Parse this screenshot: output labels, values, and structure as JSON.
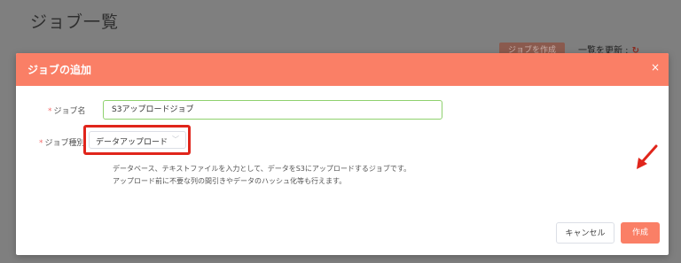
{
  "background": {
    "page_title": "ジョブ一覧",
    "create_button_label": "ジョブを作成",
    "refresh_label": "一覧を更新 :",
    "refresh_icon": "refresh-icon"
  },
  "modal": {
    "title": "ジョブの追加",
    "close_icon": "×",
    "form": {
      "job_name_label": "ジョブ名",
      "job_name_value": "S3アップロードジョブ",
      "job_type_label": "ジョブ種別",
      "job_type_value": "データアップロード",
      "required_mark": "*",
      "description_line1": "データベース、テキストファイルを入力として、データをS3にアップロードするジョブです。",
      "description_line2": "アップロード前に不要な列の間引きやデータのハッシュ化等も行えます。"
    },
    "buttons": {
      "cancel_label": "キャンセル",
      "create_label": "作成"
    }
  },
  "colors": {
    "accent": "#fa7f66",
    "highlight": "#e0251b",
    "input_valid_border": "#8fd16e"
  }
}
